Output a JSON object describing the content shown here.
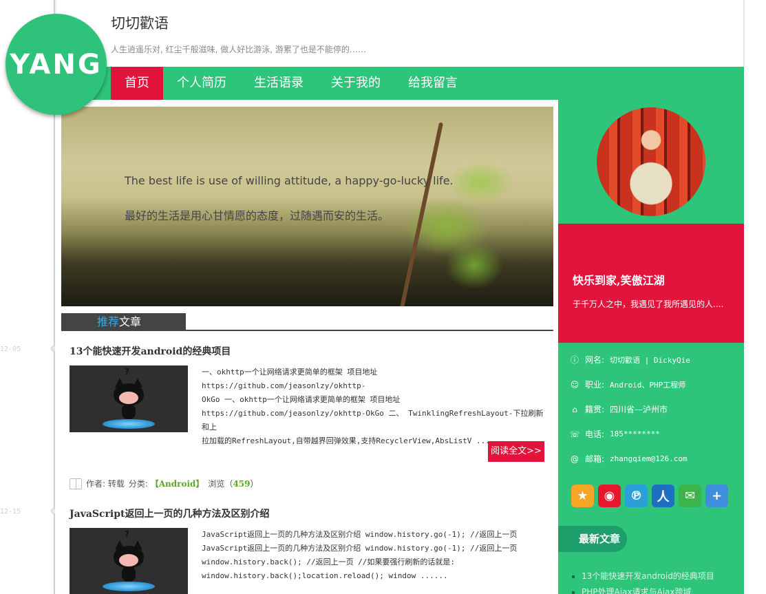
{
  "header": {
    "title": "切切歡语",
    "subtitle": "人生逍遥乐对, 红尘千般滋味, 做人好比游泳, 游累了也是不能停的……",
    "logo_text": "YANG"
  },
  "nav": [
    {
      "label": "首页",
      "active": true
    },
    {
      "label": "个人简历",
      "active": false
    },
    {
      "label": "生活语录",
      "active": false
    },
    {
      "label": "关于我的",
      "active": false
    },
    {
      "label": "给我留言",
      "active": false
    }
  ],
  "banner": {
    "line1": "The best life is use of willing attitude, a happy-go-lucky life.",
    "line2": "最好的生活是用心甘情愿的态度，过随遇而安的生活。"
  },
  "section": {
    "title_highlight": "推荐",
    "title_rest": "文章"
  },
  "timeline": {
    "dates": [
      "12-05",
      "12-15"
    ]
  },
  "articles": [
    {
      "title": "13个能快速开发android的经典项目",
      "excerpt_lines": [
        "一、okhttp一个让网络请求更简单的框架 项目地址 https://github.com/jeasonlzy/okhttp-",
        "OkGo 一、okhttp一个让网络请求更简单的框架 项目地址",
        "https://github.com/jeasonlzy/okhttp-OkGo 二、 TwinklingRefreshLayout-下拉刷新和上",
        "拉加载的RefreshLayout,自带越界回弹效果,支持RecyclerView,AbsListV ......"
      ],
      "read_more": "阅读全文>>",
      "meta_author": "作者: 转载",
      "meta_category_label": "分类: ",
      "meta_category": "【Android】",
      "meta_views_label": "浏览（",
      "meta_views": "459",
      "meta_views_end": "）"
    },
    {
      "title": "JavaScript返回上一页的几种方法及区别介绍",
      "excerpt_lines": [
        "JavaScript返回上一页的几种方法及区别介绍 window.history.go(-1); //返回上一页",
        "JavaScript返回上一页的几种方法及区别介绍 window.history.go(-1); //返回上一页",
        "window.history.back(); //返回上一页 //如果要强行刷新的话就是:",
        "window.history.back();location.reload(); window ......"
      ]
    }
  ],
  "sidebar": {
    "red_title": "快乐到家,笑傲江湖",
    "red_sub": "于千万人之中，我遇见了我所遇见的人....",
    "info": [
      {
        "icon": "info-icon",
        "label": "网名: ",
        "value": "切切歡语 | DickyQie"
      },
      {
        "icon": "user-icon",
        "label": "职业: ",
        "value": "Android、PHP工程师"
      },
      {
        "icon": "home-icon",
        "label": "籍贯: ",
        "value": "四川省—泸州市"
      },
      {
        "icon": "phone-icon",
        "label": "电话: ",
        "value": "185********"
      },
      {
        "icon": "at-icon",
        "label": "邮箱: ",
        "value": "zhangqiem@126.com"
      }
    ],
    "social": [
      {
        "name": "qzone-icon",
        "glyph": "★",
        "color": "#f5a623"
      },
      {
        "name": "weibo-icon",
        "glyph": "◉",
        "color": "#e6162d"
      },
      {
        "name": "tencent-weibo-icon",
        "glyph": "℗",
        "color": "#2b9fd8"
      },
      {
        "name": "renren-icon",
        "glyph": "人",
        "color": "#1d6fc2"
      },
      {
        "name": "wechat-icon",
        "glyph": "✉",
        "color": "#3bb54a"
      },
      {
        "name": "more-share-icon",
        "glyph": "+",
        "color": "#3f8edb"
      }
    ],
    "latest_title": "最新文章",
    "latest": [
      "13个能快速开发android的经典项目",
      "PHP处理Ajax请求与Ajax跨域"
    ]
  }
}
